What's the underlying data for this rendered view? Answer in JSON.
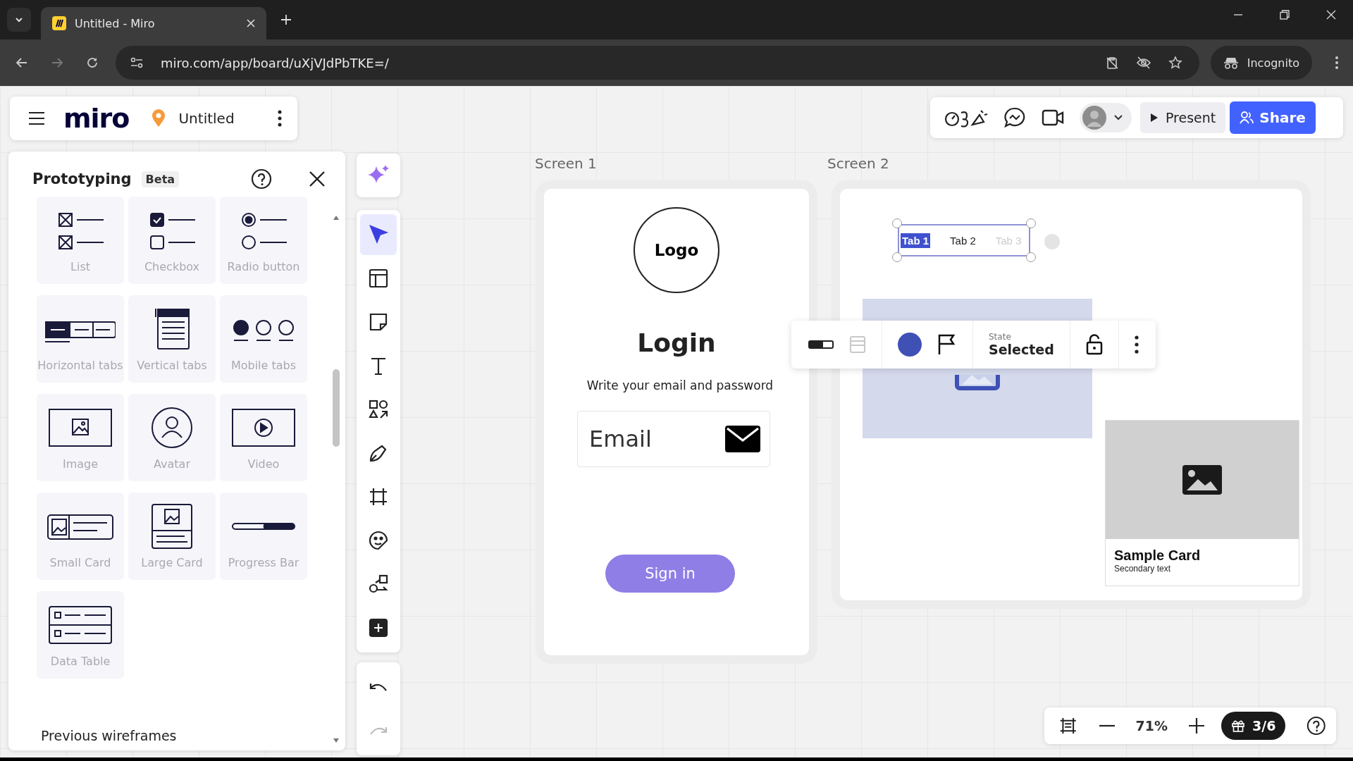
{
  "browser": {
    "tabs": [
      {
        "title": "Untitled - Miro",
        "selected": true
      }
    ],
    "url": "miro.com/app/board/uXjVJdPbTKE=/",
    "incognito": "Incognito"
  },
  "board": {
    "logo": "miro",
    "title": "Untitled"
  },
  "header_actions": {
    "present": "Present",
    "share": "Share"
  },
  "panel": {
    "title": "Prototyping",
    "badge": "Beta",
    "items": [
      {
        "label": "List",
        "kind": "list"
      },
      {
        "label": "Checkbox",
        "kind": "checkbox"
      },
      {
        "label": "Radio button",
        "kind": "radio"
      },
      {
        "label": "Horizontal tabs",
        "kind": "htabs"
      },
      {
        "label": "Vertical tabs",
        "kind": "vtabs"
      },
      {
        "label": "Mobile tabs",
        "kind": "mtabs"
      },
      {
        "label": "Image",
        "kind": "image"
      },
      {
        "label": "Avatar",
        "kind": "avatar"
      },
      {
        "label": "Video",
        "kind": "video"
      },
      {
        "label": "Small Card",
        "kind": "smallcard"
      },
      {
        "label": "Large Card",
        "kind": "largecard"
      },
      {
        "label": "Progress Bar",
        "kind": "progress"
      },
      {
        "label": "Data Table",
        "kind": "table"
      }
    ],
    "footer": "Previous wireframes"
  },
  "toolbar": {
    "tools": [
      {
        "kind": "select",
        "selected": true
      },
      {
        "kind": "templates",
        "selected": false
      },
      {
        "kind": "sticky",
        "selected": false
      },
      {
        "kind": "text",
        "selected": false
      },
      {
        "kind": "shapes",
        "selected": false
      },
      {
        "kind": "pen",
        "selected": false
      },
      {
        "kind": "frame",
        "selected": false
      },
      {
        "kind": "sticker",
        "selected": false
      },
      {
        "kind": "diagram",
        "selected": false
      },
      {
        "kind": "more",
        "selected": false
      }
    ],
    "history": [
      {
        "kind": "undo",
        "disabled": false
      },
      {
        "kind": "redo",
        "disabled": true
      }
    ]
  },
  "screens": [
    {
      "label": "Screen 1",
      "logo": "Logo",
      "heading": "Login",
      "subtitle": "Write your email and password",
      "email_field": {
        "placeholder": "Email"
      },
      "button": "Sign in"
    },
    {
      "label": "Screen 2",
      "tabs": [
        {
          "label": "Tab 1",
          "selected": true,
          "disabled": false
        },
        {
          "label": "Tab 2",
          "selected": false,
          "disabled": false
        },
        {
          "label": "Tab 3",
          "selected": false,
          "disabled": true
        }
      ],
      "context_toolbar": {
        "color": "#3f51b5",
        "state_label": "State",
        "state_value": "Selected"
      },
      "card": {
        "title": "Sample Card",
        "secondary": "Secondary text"
      }
    }
  ],
  "zoom": {
    "level": "71%",
    "gift": "3/6"
  }
}
